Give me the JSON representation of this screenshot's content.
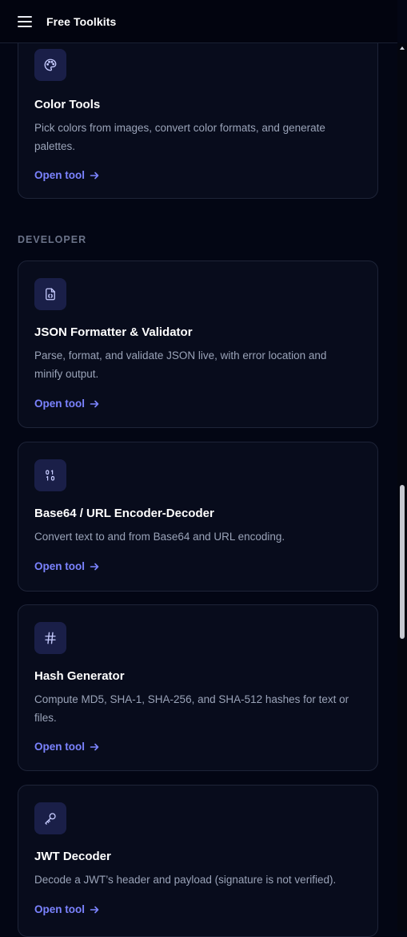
{
  "header": {
    "title": "Free Toolkits",
    "menu_icon": "hamburger-menu-icon"
  },
  "colors": {
    "background": "#030614",
    "card": "#080c1c",
    "accent": "#7b83ff",
    "icon_bg": "#1a1f48"
  },
  "sections": {
    "developer_label": "DEVELOPER"
  },
  "cards": [
    {
      "icon": "palette-icon",
      "title": "Color Tools",
      "description": "Pick colors from images, convert color formats, and generate palettes.",
      "link": "Open tool"
    },
    {
      "icon": "code-file-icon",
      "title": "JSON Formatter & Validator",
      "description": "Parse, format, and validate JSON live, with error location and minify output.",
      "link": "Open tool"
    },
    {
      "icon": "binary-icon",
      "title": "Base64 / URL Encoder-Decoder",
      "description": "Convert text to and from Base64 and URL encoding.",
      "link": "Open tool"
    },
    {
      "icon": "hash-icon",
      "title": "Hash Generator",
      "description": "Compute MD5, SHA-1, SHA-256, and SHA-512 hashes for text or files.",
      "link": "Open tool"
    },
    {
      "icon": "key-icon",
      "title": "JWT Decoder",
      "description": "Decode a JWT’s header and payload (signature is not verified).",
      "link": "Open tool"
    }
  ]
}
